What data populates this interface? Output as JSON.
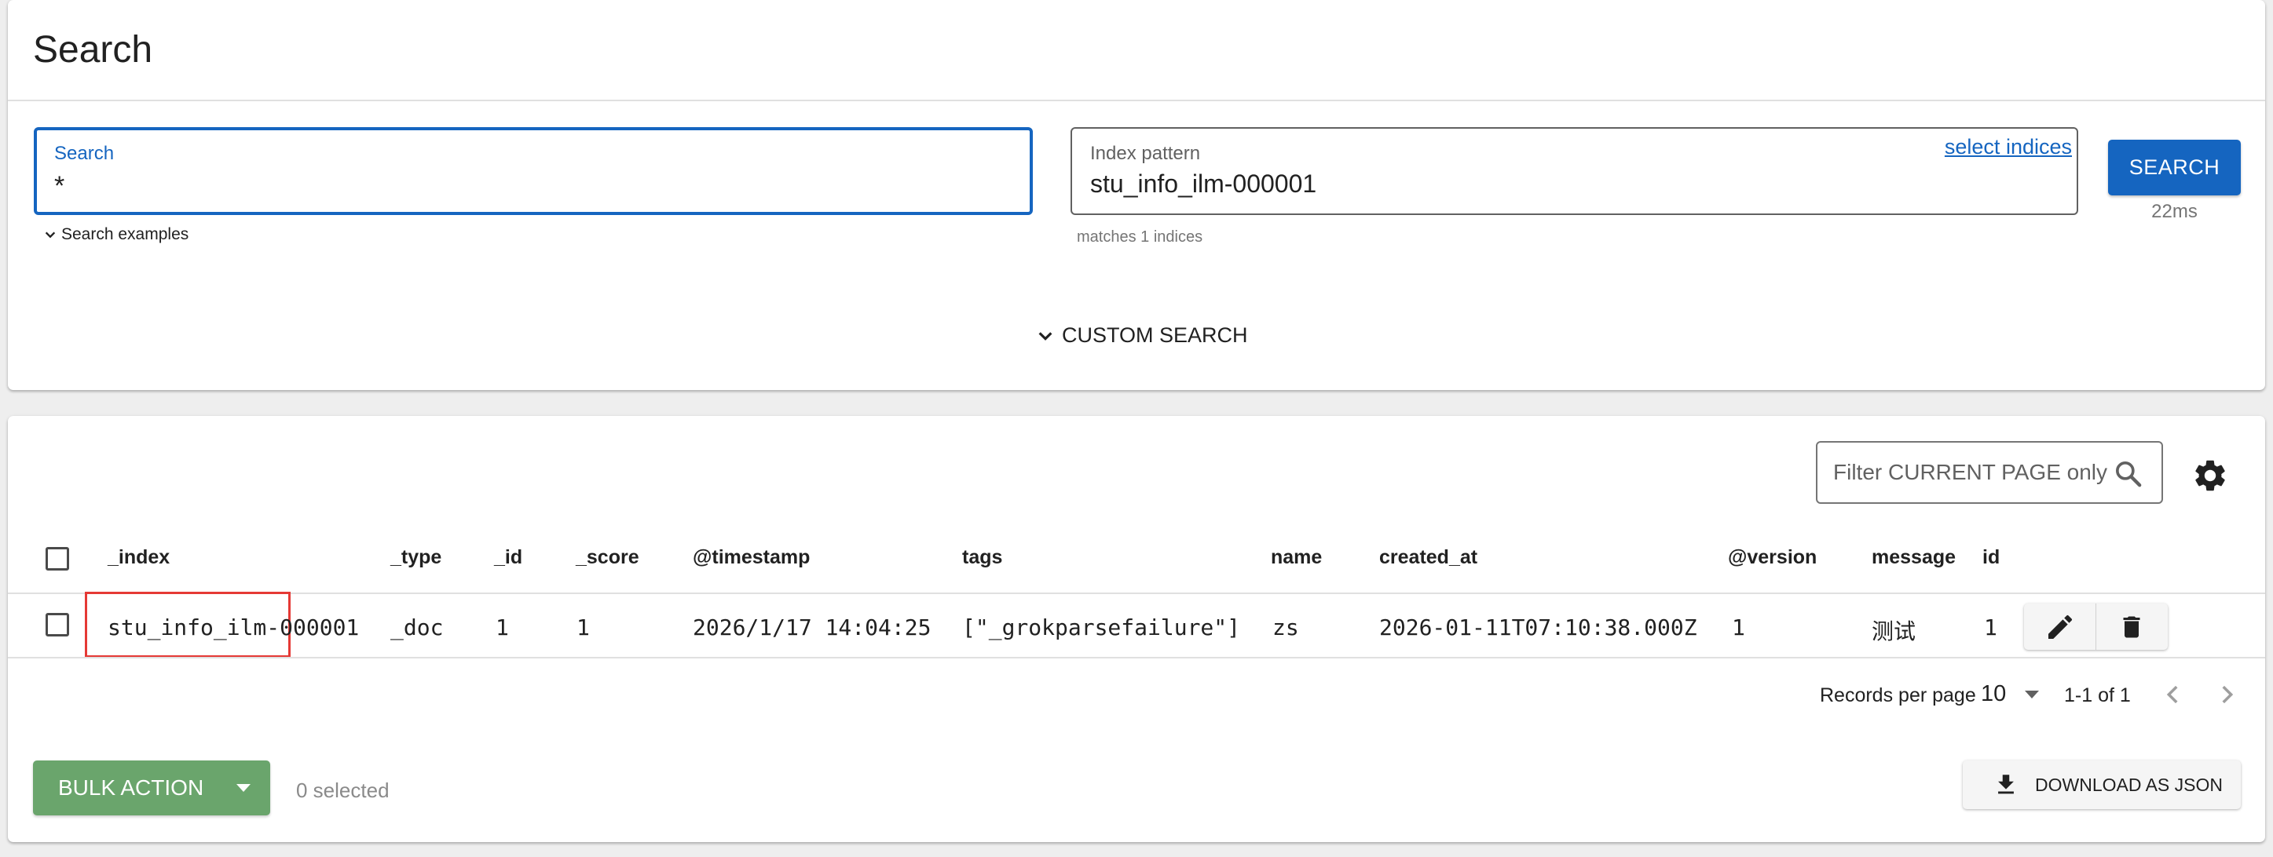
{
  "header": {
    "title": "Search"
  },
  "search": {
    "label": "Search",
    "value": "*",
    "examples_label": "Search examples"
  },
  "index": {
    "label": "Index pattern",
    "value": "stu_info_ilm-000001",
    "select_link": "select indices",
    "matches": "matches 1 indices"
  },
  "search_button": {
    "label": "SEARCH",
    "timing": "22ms"
  },
  "custom_search": {
    "label": "CUSTOM SEARCH"
  },
  "filter": {
    "placeholder": "Filter CURRENT PAGE only"
  },
  "table": {
    "columns": [
      "_index",
      "_type",
      "_id",
      "_score",
      "@timestamp",
      "tags",
      "name",
      "created_at",
      "@version",
      "message",
      "id"
    ],
    "rows": [
      [
        "stu_info_ilm-000001",
        "_doc",
        "1",
        "1",
        "2026/1/17 14:04:25",
        "[\"_grokparsefailure\"]",
        "zs",
        "2026-01-11T07:10:38.000Z",
        "1",
        "测试",
        "1"
      ]
    ]
  },
  "pagination": {
    "records_label": "Records per page",
    "per_page": "10",
    "range": "1-1 of 1"
  },
  "bulk": {
    "label": "BULK ACTION",
    "selected": "0 selected"
  },
  "download": {
    "label": "DOWNLOAD AS JSON"
  },
  "colors": {
    "primary": "#1565c0",
    "bulk_green": "#6aa56c",
    "highlight": "#e53935"
  }
}
